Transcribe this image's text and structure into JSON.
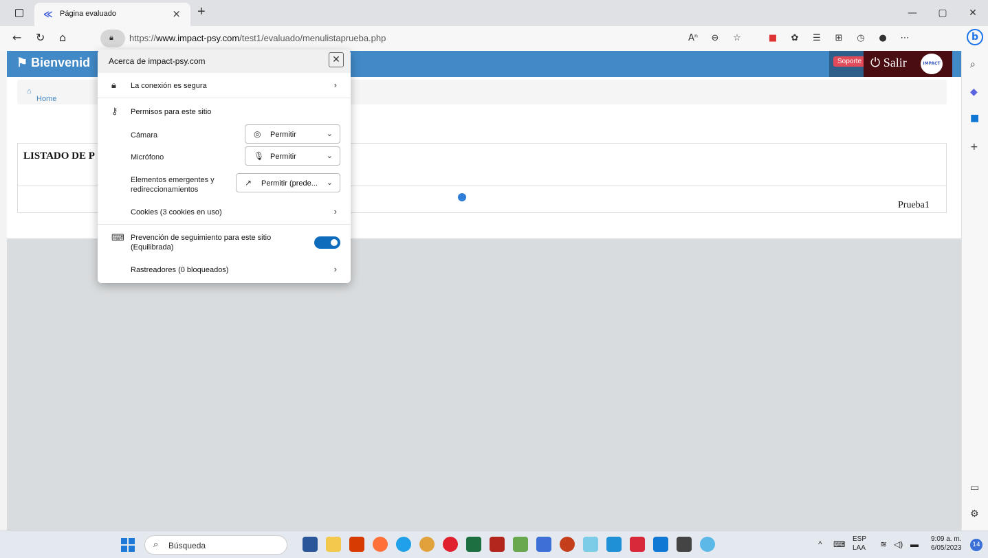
{
  "browser": {
    "tab_title": "Página evaluado",
    "url_prefix": "https://",
    "url_host": "www.impact-psy.com",
    "url_path": "/test1/evaluado/menulistaprueba.php"
  },
  "page": {
    "brand": "Bienvenid",
    "support_label": "Soporte",
    "logout_label": "Salir",
    "logo_text": "IMPACT",
    "breadcrumb_home": "Home",
    "list_title": "LISTADO DE P",
    "list_item": "Prueba1"
  },
  "popup": {
    "title": "Acerca de impact-psy.com",
    "connection": "La conexión es segura",
    "permissions_header": "Permisos para este sitio",
    "camera_label": "Cámara",
    "camera_value": "Permitir",
    "mic_label": "Micrófono",
    "mic_value": "Permitir",
    "popups_label_1": "Elementos emergentes y",
    "popups_label_2": "redireccionamientos",
    "popups_value": "Permitir (prede...",
    "cookies": "Cookies (3 cookies en uso)",
    "tracking_1": "Prevención de seguimiento para este sitio",
    "tracking_2": "(Equilibrada)",
    "tracking_enabled": true,
    "trackers": "Rastreadores (0 bloqueados)"
  },
  "taskbar": {
    "search_placeholder": "Búsqueda",
    "lang_1": "ESP",
    "lang_2": "LAA",
    "time": "9:09 a. m.",
    "date": "6/05/2023",
    "notification_count": "14"
  }
}
